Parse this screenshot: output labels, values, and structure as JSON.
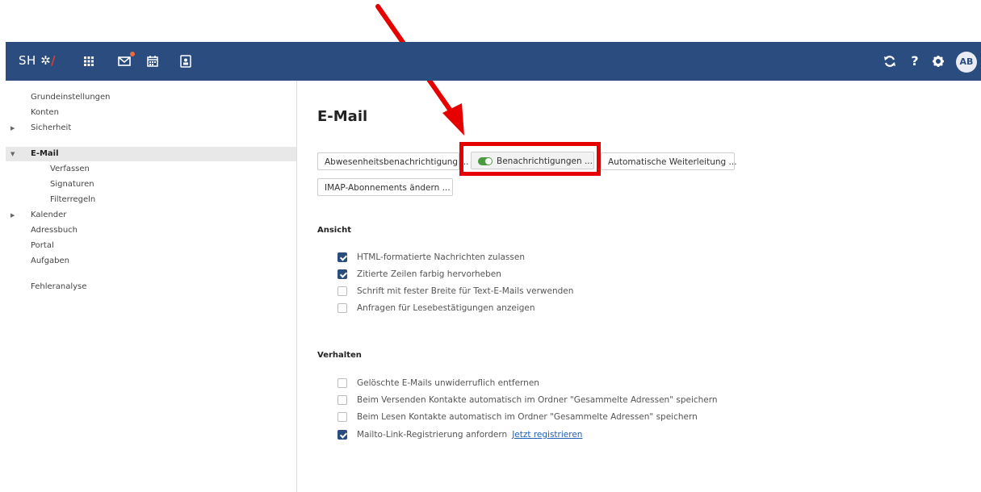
{
  "header": {
    "brand_prefix": "SH",
    "avatar_initials": "AB",
    "icons": [
      "apps-grid-icon",
      "mail-icon",
      "calendar-icon",
      "contacts-icon"
    ],
    "right_icons": [
      "refresh-icon",
      "help-icon",
      "settings-icon"
    ]
  },
  "sidebar": {
    "items": [
      {
        "label": "Grundeinstellungen"
      },
      {
        "label": "Konten"
      },
      {
        "label": "Sicherheit"
      },
      {
        "label": "E-Mail"
      },
      {
        "label": "Verfassen"
      },
      {
        "label": "Signaturen"
      },
      {
        "label": "Filterregeln"
      },
      {
        "label": "Kalender"
      },
      {
        "label": "Adressbuch"
      },
      {
        "label": "Portal"
      },
      {
        "label": "Aufgaben"
      },
      {
        "label": "Fehleranalyse"
      }
    ]
  },
  "main": {
    "title": "E-Mail",
    "buttons": [
      {
        "label": "Abwesenheitsbenachrichtigung ..."
      },
      {
        "label": "Benachrichtigungen ..."
      },
      {
        "label": "Automatische Weiterleitung ..."
      },
      {
        "label": "IMAP-Abonnements ändern ..."
      }
    ],
    "sections": {
      "ansicht": {
        "title": "Ansicht",
        "options": [
          {
            "label": "HTML-formatierte Nachrichten zulassen",
            "checked": true
          },
          {
            "label": "Zitierte Zeilen farbig hervorheben",
            "checked": true
          },
          {
            "label": "Schrift mit fester Breite für Text-E-Mails verwenden",
            "checked": false
          },
          {
            "label": "Anfragen für Lesebestätigungen anzeigen",
            "checked": false
          }
        ]
      },
      "verhalten": {
        "title": "Verhalten",
        "options": [
          {
            "label": "Gelöschte E-Mails unwiderruflich entfernen",
            "checked": false
          },
          {
            "label": "Beim Versenden Kontakte automatisch im Ordner \"Gesammelte Adressen\" speichern",
            "checked": false
          },
          {
            "label": "Beim Lesen Kontakte automatisch im Ordner \"Gesammelte Adressen\" speichern",
            "checked": false
          },
          {
            "label": "Mailto-Link-Registrierung anfordern",
            "checked": true,
            "link": "Jetzt registrieren"
          }
        ]
      }
    }
  },
  "colors": {
    "topbar": "#2b4c7e",
    "highlight": "#e60000",
    "toggle_on": "#4a9a3e"
  }
}
